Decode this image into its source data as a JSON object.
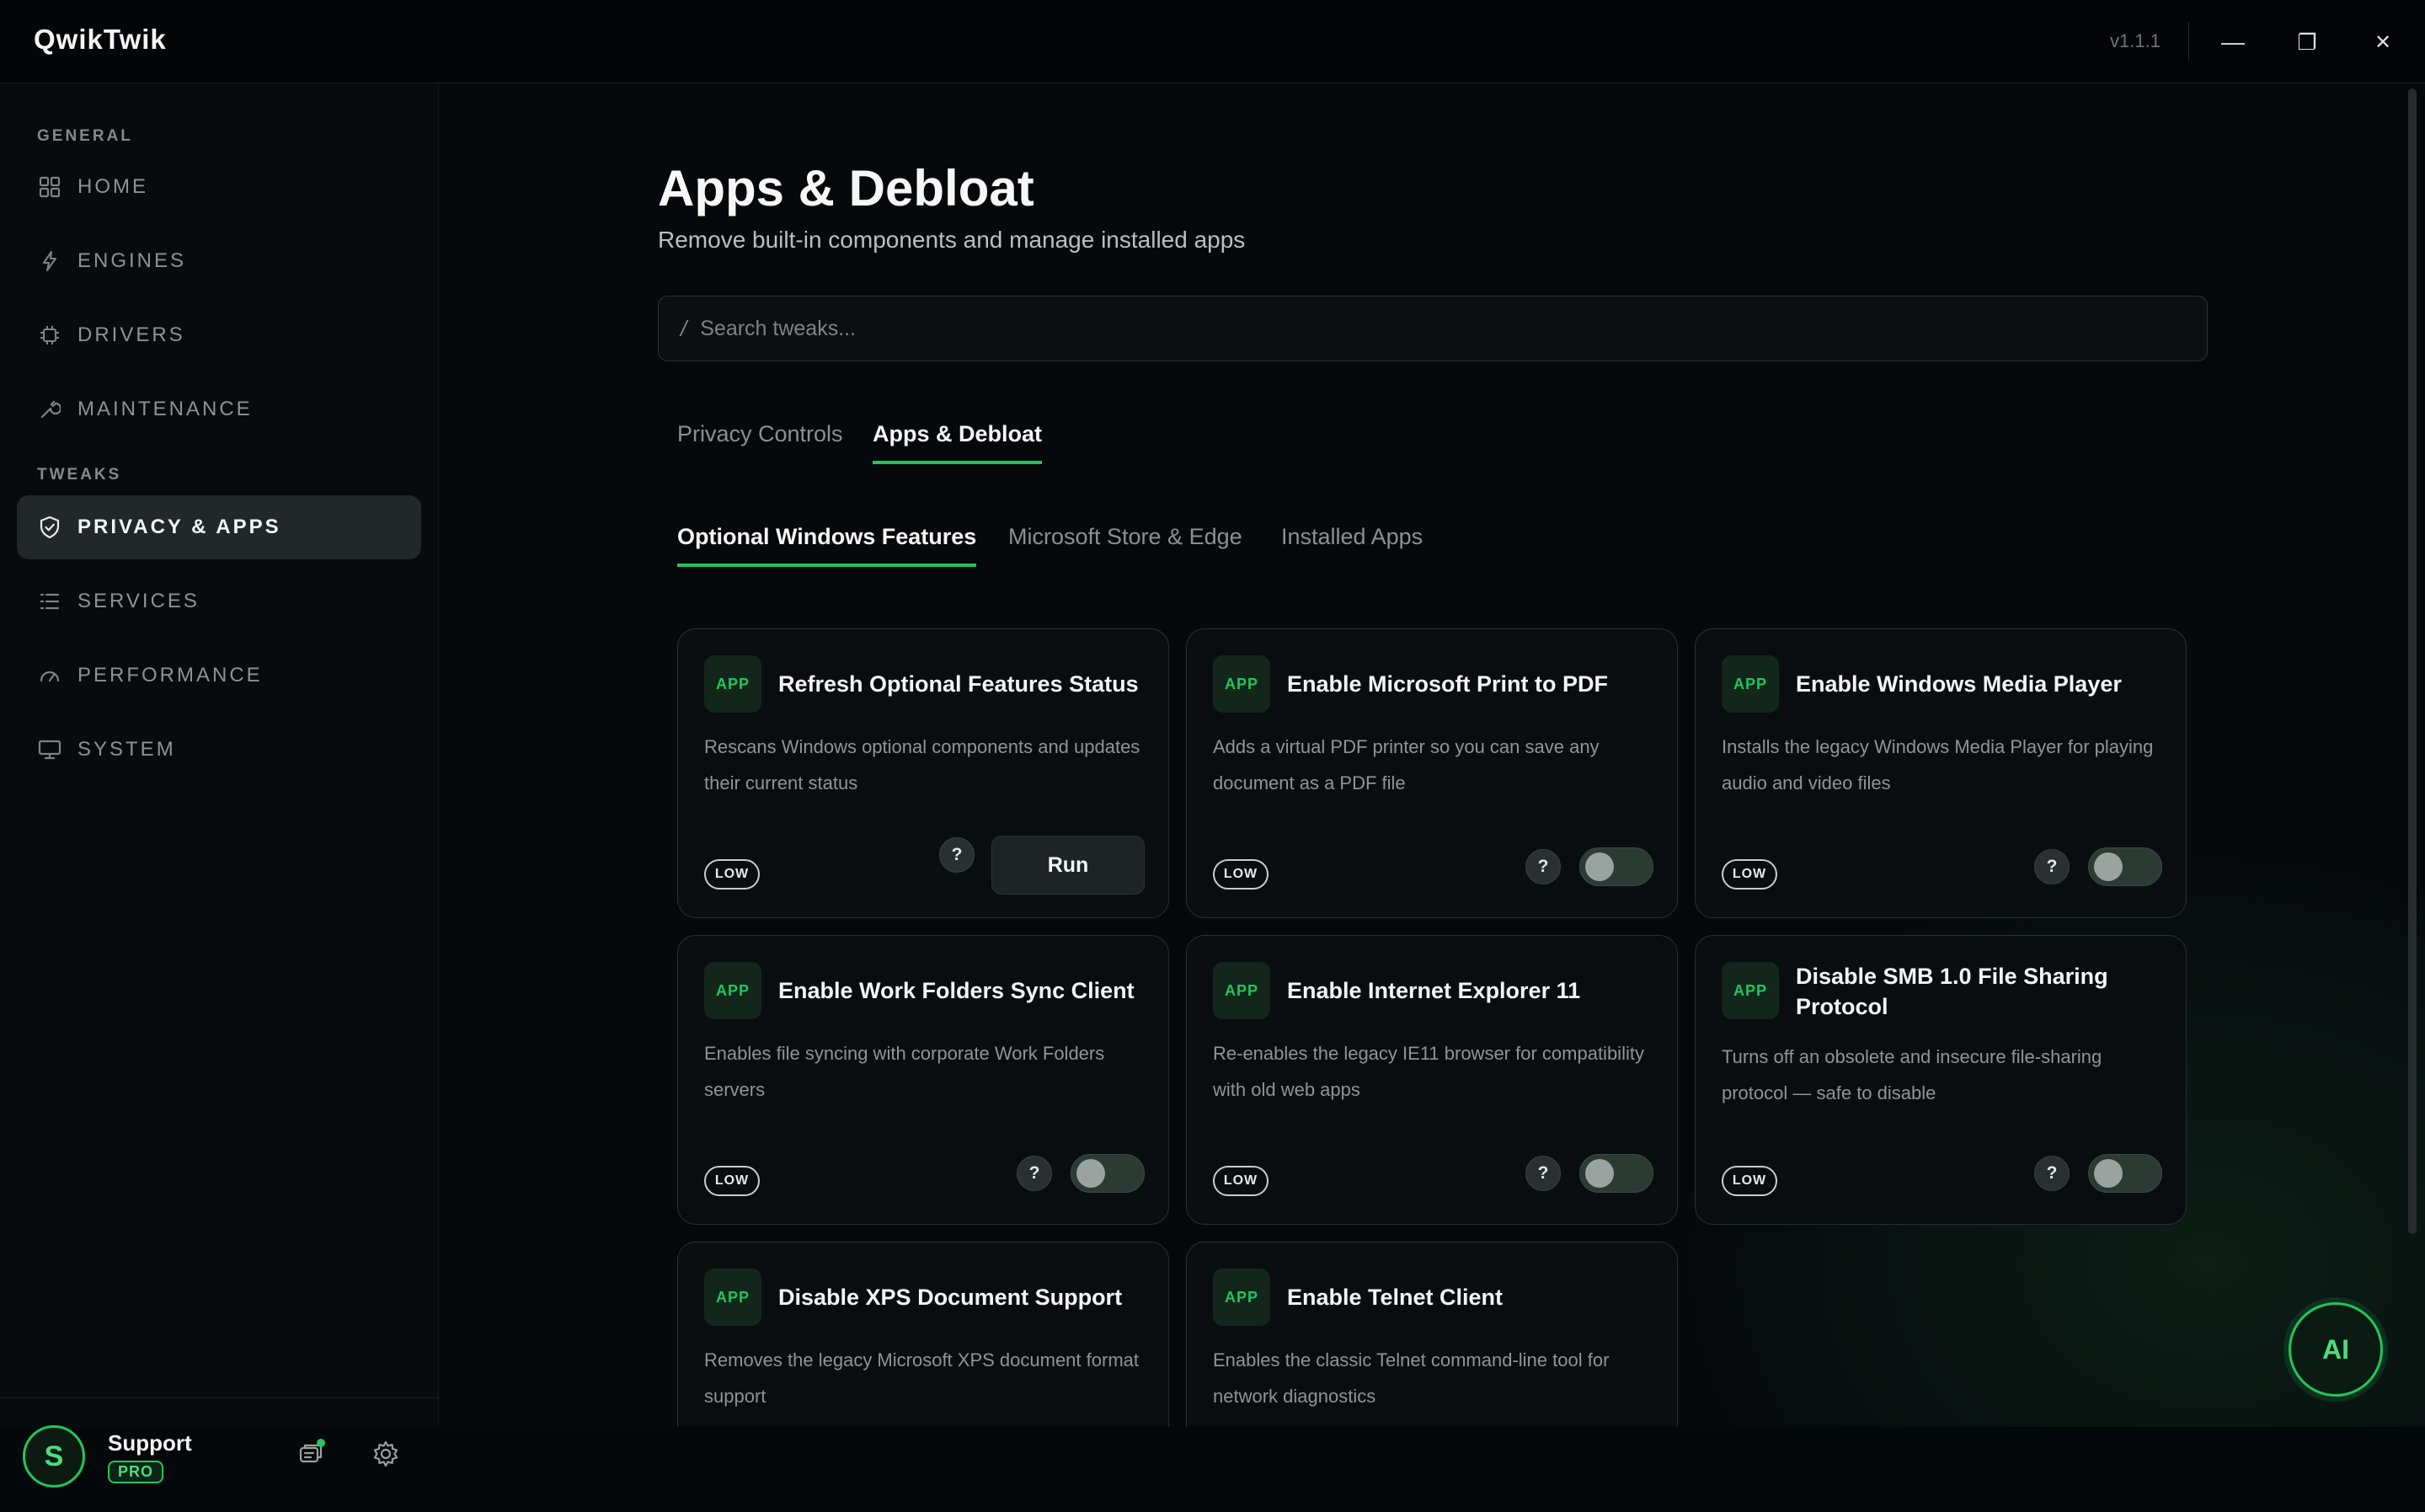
{
  "titlebar": {
    "app_name": "QwikTwik",
    "version": "v1.1.1",
    "minimize": "—",
    "maximize": "❐",
    "close": "✕"
  },
  "sidebar": {
    "general_label": "GENERAL",
    "tweaks_label": "TWEAKS",
    "items": [
      {
        "label": "HOME",
        "icon": "grid-icon"
      },
      {
        "label": "ENGINES",
        "icon": "bolt-icon"
      },
      {
        "label": "DRIVERS",
        "icon": "chip-icon"
      },
      {
        "label": "MAINTENANCE",
        "icon": "wrench-icon"
      },
      {
        "label": "PRIVACY & APPS",
        "icon": "shield-icon",
        "active": true
      },
      {
        "label": "SERVICES",
        "icon": "list-icon"
      },
      {
        "label": "PERFORMANCE",
        "icon": "gauge-icon"
      },
      {
        "label": "SYSTEM",
        "icon": "monitor-icon"
      }
    ],
    "footer": {
      "avatar_initial": "S",
      "user_name": "Support",
      "plan": "PRO"
    }
  },
  "main": {
    "title": "Apps & Debloat",
    "subtitle": "Remove built-in components and manage installed apps",
    "search": {
      "icon": "/",
      "placeholder": "Search tweaks..."
    },
    "tabs": [
      {
        "label": "Privacy Controls",
        "active": false
      },
      {
        "label": "Apps & Debloat",
        "active": true
      }
    ],
    "subtabs": [
      {
        "label": "Optional Windows Features",
        "active": true
      },
      {
        "label": "Microsoft Store & Edge",
        "active": false
      },
      {
        "label": "Installed Apps",
        "active": false
      }
    ],
    "cards": [
      {
        "badge": "APP",
        "title": "Refresh Optional Features Status",
        "desc": "Rescans Windows optional components and updates their current status",
        "risk": "LOW",
        "help": "?",
        "control": "button",
        "button_label": "Run"
      },
      {
        "badge": "APP",
        "title": "Enable Microsoft Print to PDF",
        "desc": "Adds a virtual PDF printer so you can save any document as a PDF file",
        "risk": "LOW",
        "help": "?",
        "control": "toggle",
        "enabled": false
      },
      {
        "badge": "APP",
        "title": "Enable Windows Media Player",
        "desc": "Installs the legacy Windows Media Player for playing audio and video files",
        "risk": "LOW",
        "help": "?",
        "control": "toggle",
        "enabled": false
      },
      {
        "badge": "APP",
        "title": "Enable Work Folders Sync Client",
        "desc": "Enables file syncing with corporate Work Folders servers",
        "risk": "LOW",
        "help": "?",
        "control": "toggle",
        "enabled": false
      },
      {
        "badge": "APP",
        "title": "Enable Internet Explorer 11",
        "desc": "Re-enables the legacy IE11 browser for compatibility with old web apps",
        "risk": "LOW",
        "help": "?",
        "control": "toggle",
        "enabled": false
      },
      {
        "badge": "APP",
        "title": "Disable SMB 1.0 File Sharing Protocol",
        "desc": "Turns off an obsolete and insecure file-sharing protocol — safe to disable",
        "risk": "LOW",
        "help": "?",
        "control": "toggle",
        "enabled": false
      },
      {
        "badge": "APP",
        "title": "Disable XPS Document Support",
        "desc": "Removes the legacy Microsoft XPS document format support"
      },
      {
        "badge": "APP",
        "title": "Enable Telnet Client",
        "desc": "Enables the classic Telnet command-line tool for network diagnostics"
      }
    ],
    "ai_button": "AI"
  },
  "colors": {
    "accent": "#22c55e",
    "background": "#06090b",
    "card_border": "#2a3032"
  }
}
